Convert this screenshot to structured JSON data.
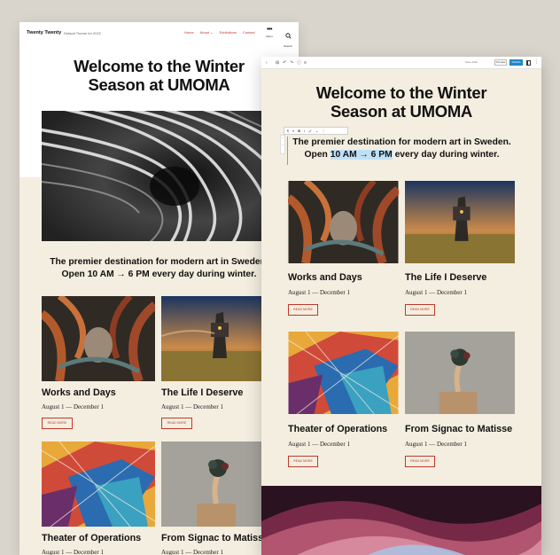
{
  "site": {
    "title": "Twenty Twenty",
    "tagline": "Default Theme for 2022",
    "nav": [
      "Home",
      "About",
      "Exhibitions",
      "Contact"
    ],
    "menu_label": "Menu",
    "search_label": "Search"
  },
  "hero": {
    "title_line1": "Welcome to the Winter",
    "title_line2": "Season at UMOMA",
    "sub_line1": "The premier destination for modern art in Sweden.",
    "sub_line2_pre": "Open ",
    "sub_line2_hl": "10 AM → 6 PM",
    "sub_line2_post": " every day during winter.",
    "back_sub_line1": "The premier destination for modern art in Sweden.",
    "back_sub_line2": "Open 10 AM → 6 PM every day during winter."
  },
  "cards": [
    {
      "title": "Works and Days",
      "dates": "August 1 — December 1",
      "button": "READ MORE"
    },
    {
      "title": "The Life I Deserve",
      "dates": "August 1 — December 1",
      "button": "READ MORE"
    },
    {
      "title": "Theater of Operations",
      "dates": "August 1 — December 1",
      "button": "READ MORE"
    },
    {
      "title": "From Signac to Matisse",
      "dates": "August 1 — December 1",
      "button": "READ MORE"
    }
  ],
  "editor": {
    "save_draft": "Save draft",
    "preview": "Preview",
    "publish": "Publish",
    "block_tools": [
      "¶",
      "≡",
      "B",
      "I",
      "🔗",
      "⌄",
      "⋮"
    ]
  },
  "colors": {
    "accent": "#c0392b",
    "page_bg": "#f4eee0",
    "publish": "#1e88c7"
  }
}
